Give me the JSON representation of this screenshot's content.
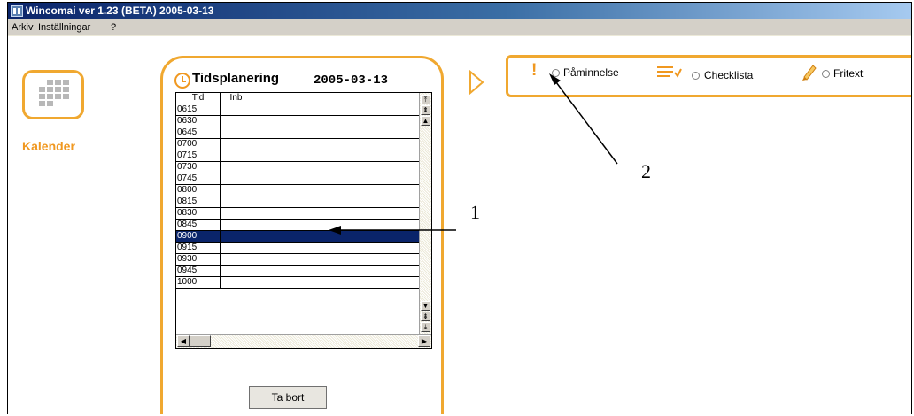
{
  "window": {
    "title": "Wincomai ver 1.23 (BETA) 2005-03-13"
  },
  "menu": {
    "items": [
      "Arkiv",
      "Inställningar",
      "?"
    ]
  },
  "sidebar": {
    "calendar_label": "Kalender"
  },
  "planner": {
    "title": "Tidsplanering",
    "date": "2005-03-13",
    "columns": [
      "Tid",
      "Inb"
    ],
    "rows": [
      "0615",
      "0630",
      "0645",
      "0700",
      "0715",
      "0730",
      "0745",
      "0800",
      "0815",
      "0830",
      "0845",
      "0900",
      "0915",
      "0930",
      "0945",
      "1000"
    ],
    "selected_row": "0900",
    "delete_label": "Ta bort"
  },
  "entry_types": {
    "options": [
      "Påminnelse",
      "Checklista",
      "Fritext"
    ],
    "icons": [
      "exclamation-icon",
      "checklist-icon",
      "pencil-icon"
    ]
  },
  "callouts": {
    "one": "1",
    "two": "2"
  },
  "colors": {
    "accent": "#f0a830",
    "selection": "#0a246a"
  }
}
